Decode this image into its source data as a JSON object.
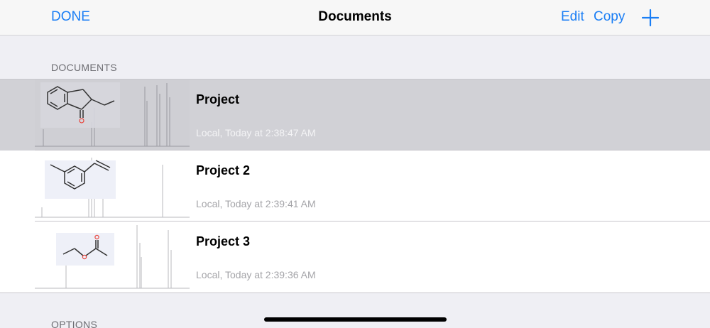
{
  "navbar": {
    "done_label": "DONE",
    "title": "Documents",
    "edit_label": "Edit",
    "copy_label": "Copy",
    "add_icon": "plus-icon",
    "accent_color": "#1a7ef5"
  },
  "sections": {
    "documents_header": "DOCUMENTS",
    "options_header": "OPTIONS"
  },
  "documents": [
    {
      "title": "Project",
      "subtitle": "Local, Today at 2:38:47 AM",
      "selected": true,
      "thumbnail": "indanone-spectrum-thumbnail"
    },
    {
      "title": "Project 2",
      "subtitle": "Local, Today at 2:39:41 AM",
      "selected": false,
      "thumbnail": "styrene-spectrum-thumbnail"
    },
    {
      "title": "Project 3",
      "subtitle": "Local, Today at 2:39:36 AM",
      "selected": false,
      "thumbnail": "ethyl-acetate-spectrum-thumbnail"
    }
  ],
  "colors": {
    "selected_row": "#d1d1d6",
    "background": "#efeff4",
    "oxygen": "#e8453c"
  }
}
